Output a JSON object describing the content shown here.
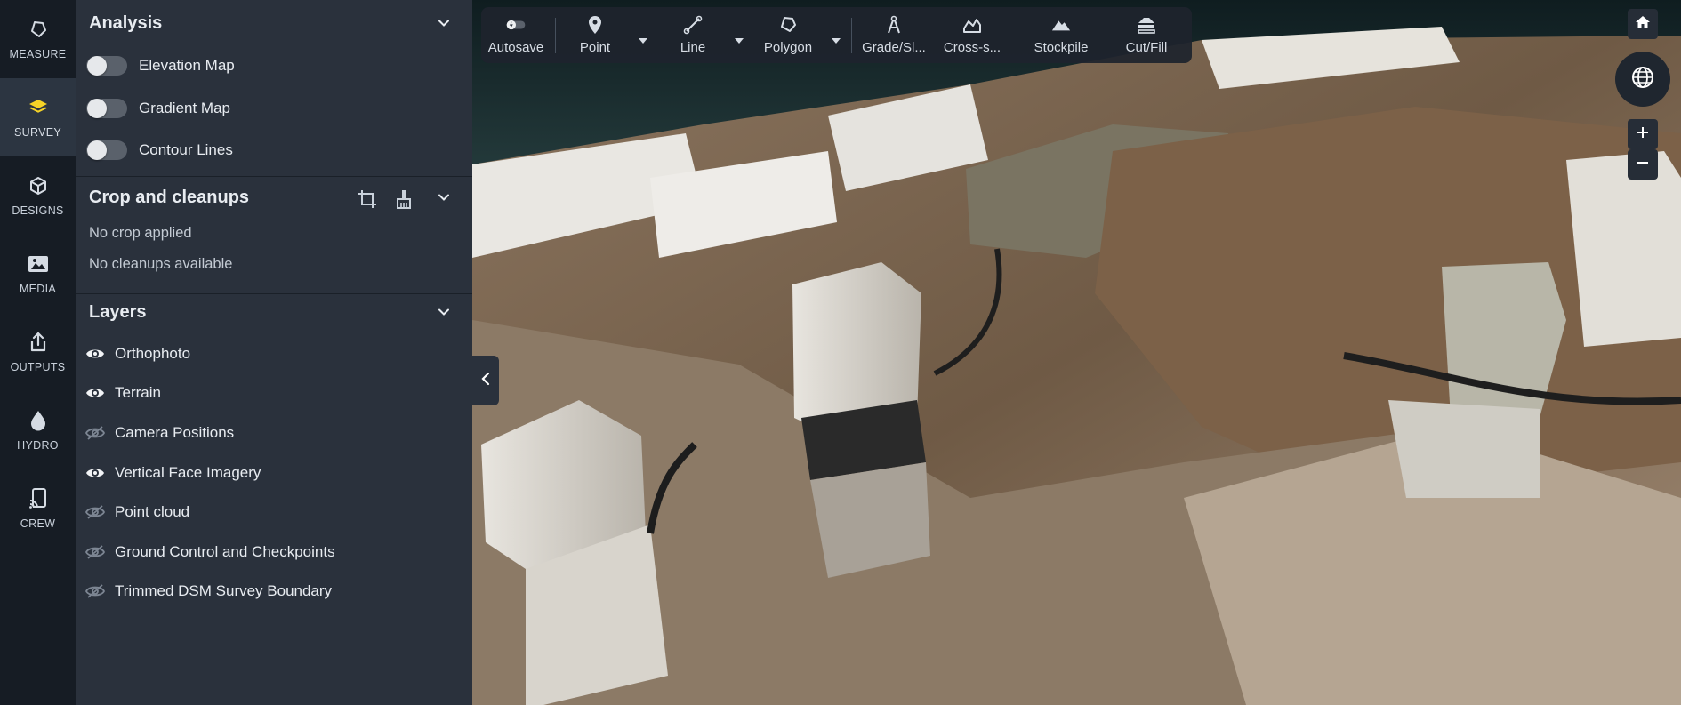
{
  "rail": {
    "items": [
      {
        "label": "MEASURE",
        "icon": "polygon-icon"
      },
      {
        "label": "SURVEY",
        "icon": "layers-icon",
        "active": true
      },
      {
        "label": "DESIGNS",
        "icon": "cube-icon"
      },
      {
        "label": "MEDIA",
        "icon": "image-icon"
      },
      {
        "label": "OUTPUTS",
        "icon": "share-icon"
      },
      {
        "label": "HYDRO",
        "icon": "drop-icon"
      },
      {
        "label": "CREW",
        "icon": "device-icon"
      }
    ]
  },
  "analysis": {
    "title": "Analysis",
    "toggles": [
      {
        "label": "Elevation Map",
        "on": false
      },
      {
        "label": "Gradient Map",
        "on": false
      },
      {
        "label": "Contour Lines",
        "on": false
      }
    ]
  },
  "crop": {
    "title": "Crop and cleanups",
    "no_crop": "No crop applied",
    "no_cleanups": "No cleanups available"
  },
  "layers": {
    "title": "Layers",
    "items": [
      {
        "label": "Orthophoto",
        "visible": true
      },
      {
        "label": "Terrain",
        "visible": true
      },
      {
        "label": "Camera Positions",
        "visible": false
      },
      {
        "label": "Vertical Face Imagery",
        "visible": true
      },
      {
        "label": "Point cloud",
        "visible": false
      },
      {
        "label": "Ground Control and Checkpoints",
        "visible": false
      },
      {
        "label": "Trimmed DSM Survey Boundary",
        "visible": false
      }
    ]
  },
  "toolbar": {
    "autosave": "Autosave",
    "point": "Point",
    "line": "Line",
    "polygon": "Polygon",
    "grade": "Grade/Sl...",
    "cross": "Cross-s...",
    "stockpile": "Stockpile",
    "cutfill": "Cut/Fill"
  },
  "colors": {
    "rail_bg": "#161c24",
    "panel_bg": "#2a313c",
    "accent_yellow": "#f5d327"
  }
}
